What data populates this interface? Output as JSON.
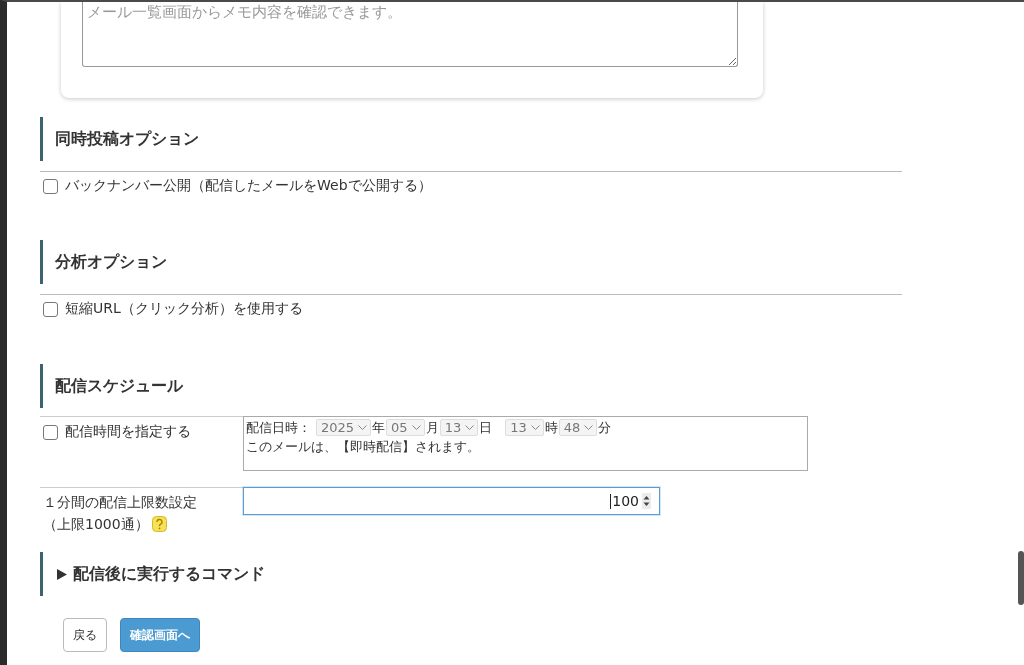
{
  "memo_card": {
    "textarea": {
      "placeholder": "メール一覧画面からメモ内容を確認できます。"
    }
  },
  "sections": [
    {
      "title": "同時投稿オプション",
      "options": [
        {
          "label": "バックナンバー公開（配信したメールをWebで公開する）",
          "checked": false
        }
      ]
    },
    {
      "title": "分析オプション",
      "options": [
        {
          "label": "短縮URL（クリック分析）を使用する",
          "checked": false
        }
      ]
    }
  ],
  "schedule": {
    "title": "配信スケジュール",
    "specify_time": {
      "label": "配信時間を指定する",
      "checked": false
    },
    "datetime": {
      "label": "配信日時：",
      "disabled": true,
      "date": [
        {
          "value": "2025",
          "unit": "年"
        },
        {
          "value": "05",
          "unit": "月"
        },
        {
          "value": "13",
          "unit": "日"
        }
      ],
      "time": [
        {
          "value": "13",
          "unit": "時"
        },
        {
          "value": "48",
          "unit": "分"
        }
      ]
    },
    "notice": "このメールは、【即時配信】されます。",
    "rate_limit": {
      "label": "１分間の配信上限数設定",
      "note": "（上限1000通）",
      "value": "100"
    }
  },
  "command_section": {
    "title": "配信後に実行するコマンド",
    "expanded": false
  },
  "buttons": [
    {
      "kind": "secondary",
      "label": "戻る"
    },
    {
      "kind": "primary",
      "label": "確認画面へ"
    }
  ]
}
